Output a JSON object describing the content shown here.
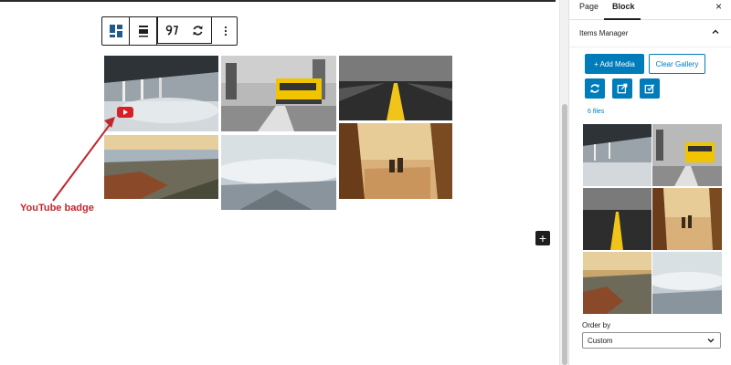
{
  "toolbar": {
    "buttons": [
      "gallery-layout-icon",
      "align-icon",
      "youtube-quote-icon",
      "refresh-icon",
      "more-options-icon"
    ]
  },
  "annotation": {
    "label": "YouTube badge"
  },
  "add_block": {
    "symbol": "+"
  },
  "sidebar": {
    "tabs": {
      "page": "Page",
      "block": "Block"
    },
    "close_symbol": "×",
    "panel_title": "Items Manager",
    "add_media_label": "+ Add Media",
    "clear_gallery_label": "Clear Gallery",
    "files_count": "6 files",
    "order_by_label": "Order by",
    "order_by_value": "Custom"
  },
  "colors": {
    "accent": "#007cba",
    "youtube_red": "#d91f26",
    "annotation_red": "#c0272d",
    "dark": "#1e1e1e"
  }
}
